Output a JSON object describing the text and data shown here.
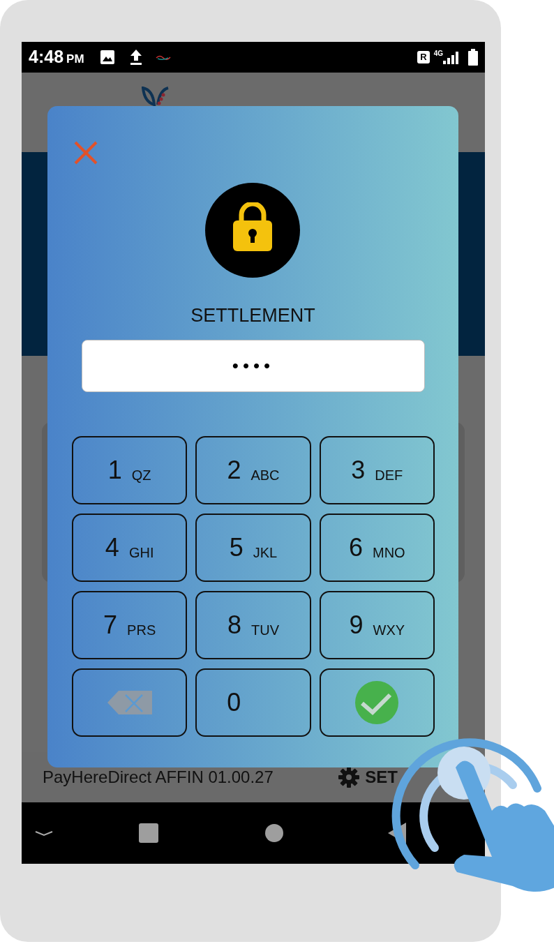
{
  "status_bar": {
    "time": "4:48",
    "ampm": "PM",
    "roaming": "R",
    "network": "4G"
  },
  "app": {
    "footer_text": "PayHereDirect AFFIN 01.00.27",
    "settings_label": "SET"
  },
  "dialog": {
    "title": "SETTLEMENT",
    "pin_value": "••••",
    "keys": [
      {
        "kind": "digit",
        "digit": "1",
        "letters": "QZ"
      },
      {
        "kind": "digit",
        "digit": "2",
        "letters": "ABC"
      },
      {
        "kind": "digit",
        "digit": "3",
        "letters": "DEF"
      },
      {
        "kind": "digit",
        "digit": "4",
        "letters": "GHI"
      },
      {
        "kind": "digit",
        "digit": "5",
        "letters": "JKL"
      },
      {
        "kind": "digit",
        "digit": "6",
        "letters": "MNO"
      },
      {
        "kind": "digit",
        "digit": "7",
        "letters": "PRS"
      },
      {
        "kind": "digit",
        "digit": "8",
        "letters": "TUV"
      },
      {
        "kind": "digit",
        "digit": "9",
        "letters": "WXY"
      },
      {
        "kind": "backspace"
      },
      {
        "kind": "digit",
        "digit": "0"
      },
      {
        "kind": "confirm"
      }
    ]
  }
}
